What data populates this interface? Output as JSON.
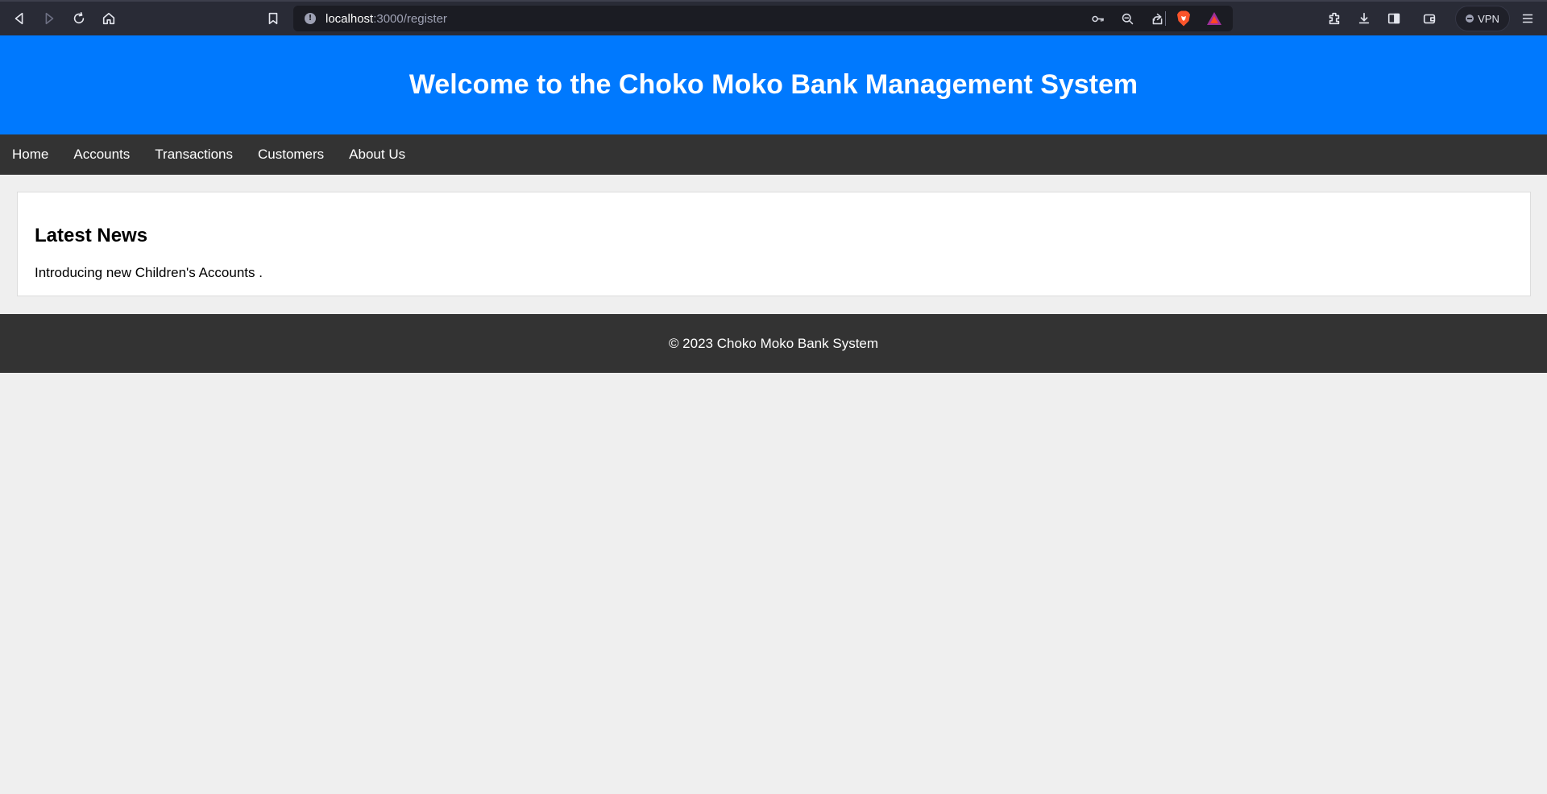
{
  "browser": {
    "url_host": "localhost",
    "url_path": ":3000/register",
    "vpn_label": "VPN"
  },
  "header": {
    "title": "Welcome to the Choko Moko Bank Management System"
  },
  "nav": {
    "items": [
      {
        "label": "Home"
      },
      {
        "label": "Accounts"
      },
      {
        "label": "Transactions"
      },
      {
        "label": "Customers"
      },
      {
        "label": "About Us"
      }
    ]
  },
  "news": {
    "heading": "Latest News",
    "text": "Introducing new Children's Accounts ."
  },
  "footer": {
    "text": "© 2023 Choko Moko Bank System"
  },
  "colors": {
    "header_bg": "#0079fe",
    "nav_bg": "#333333",
    "page_bg": "#efefef",
    "browser_bg": "#292b36"
  }
}
